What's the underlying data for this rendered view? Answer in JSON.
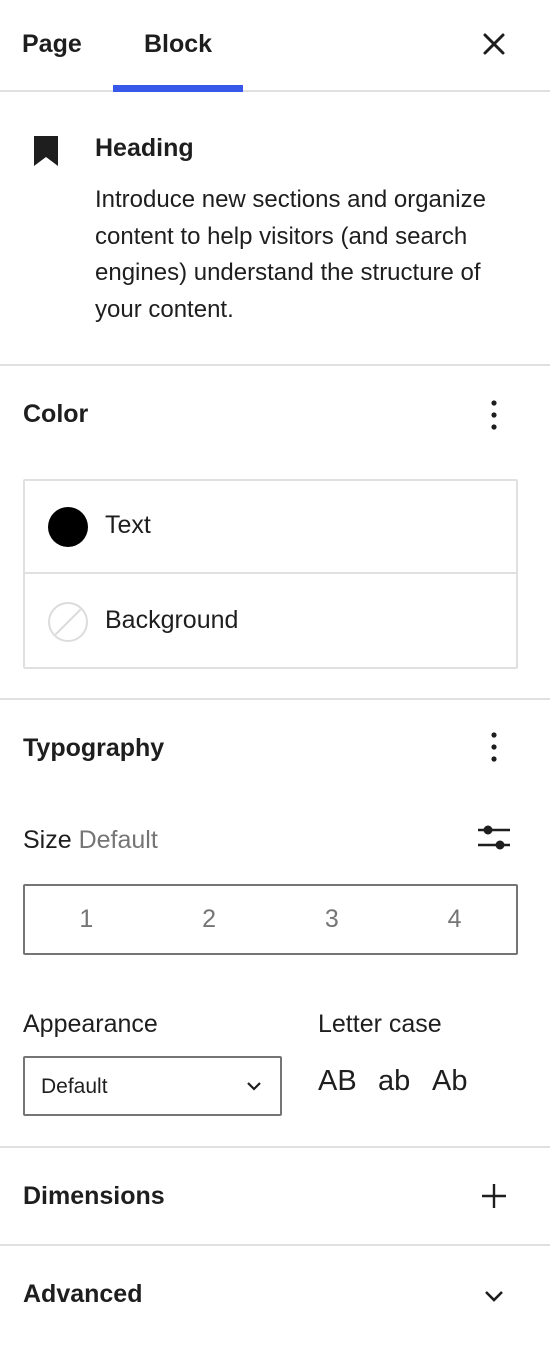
{
  "tabs": {
    "page_label": "Page",
    "block_label": "Block",
    "active": "Block"
  },
  "block_card": {
    "icon": "bookmark-icon",
    "title": "Heading",
    "description": "Introduce new sections and organize content to help visitors (and search engines) understand the structure of your content."
  },
  "color": {
    "title": "Color",
    "items": [
      {
        "label": "Text",
        "swatch": "#000000"
      },
      {
        "label": "Background",
        "swatch": "none"
      }
    ]
  },
  "typography": {
    "title": "Typography",
    "size_label": "Size",
    "size_value": "Default",
    "size_options": [
      "1",
      "2",
      "3",
      "4"
    ],
    "appearance_label": "Appearance",
    "appearance_value": "Default",
    "letter_case_label": "Letter case",
    "letter_case_options": [
      "AB",
      "ab",
      "Ab"
    ]
  },
  "dimensions": {
    "title": "Dimensions"
  },
  "advanced": {
    "title": "Advanced"
  },
  "colors": {
    "accent": "#3858e9",
    "text": "#1e1e1e",
    "muted": "#757575",
    "border": "#e0e0e0"
  }
}
